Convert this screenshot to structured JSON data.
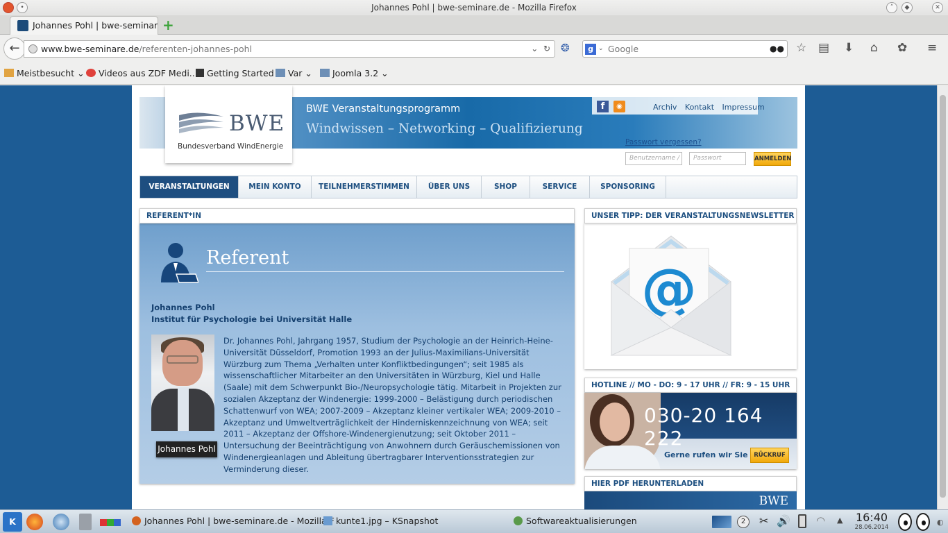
{
  "window": {
    "title": "Johannes Pohl | bwe-seminare.de - Mozilla Firefox"
  },
  "browser": {
    "tab_title": "Johannes Pohl | bwe-seminar…",
    "url_domain": "www.bwe-seminare.de",
    "url_path": "/referenten-johannes-pohl",
    "search_placeholder": "Google",
    "bookmarks": [
      "Meistbesucht",
      "Videos aus ZDF Medi...",
      "Getting Started",
      "Var",
      "Joomla 3.2"
    ]
  },
  "site": {
    "logo_text": "BWE",
    "logo_subtitle": "Bundesverband WindEnergie",
    "header_title": "BWE Veranstaltungsprogramm",
    "header_slogan": "Windwissen – Networking – Qualifizierung",
    "top_links": [
      "Archiv",
      "Kontakt",
      "Impressum"
    ],
    "password_forgot": "Passwort vergessen?",
    "username_placeholder": "Benutzername / E",
    "password_placeholder": "Passwort",
    "login_button": "ANMELDEN",
    "nav": [
      "VERANSTALTUNGEN",
      "MEIN KONTO",
      "TEILNEHMERSTIMMEN",
      "ÜBER UNS",
      "SHOP",
      "SERVICE",
      "SPONSORING"
    ],
    "nav_active": "VERANSTALTUNGEN"
  },
  "referent": {
    "box_label": "REFERENT*IN",
    "heading": "Referent",
    "name": "Johannes Pohl",
    "institution": "Institut für Psychologie bei Universität Halle",
    "photo_caption": "Johannes Pohl",
    "bio": "Dr. Johannes Pohl, Jahrgang 1957, Studium der Psychologie an der Heinrich-Heine-Universität Düsseldorf, Promotion 1993 an der Julius-Maximilians-Universität Würzburg zum Thema „Verhalten unter Konfliktbedingungen“; seit 1985 als wissenschaftlicher Mitarbeiter an den Universitäten in Würzburg, Kiel und Halle (Saale) mit dem Schwerpunkt Bio-/Neuropsychologie tätig. Mitarbeit in Projekten zur sozialen Akzeptanz der Windenergie: 1999-2000 – Belästigung durch periodischen Schattenwurf von WEA; 2007-2009 – Akzeptanz kleiner vertikaler WEA; 2009-2010 – Akzeptanz und Umweltverträglichkeit der Hinderniskennzeichnung von WEA; seit 2011 – Akzeptanz der Offshore-Windenergienutzung; seit Oktober 2011 – Untersuchung der Beeinträchtigung von Anwohnern durch Geräuschemissionen von Windenergieanlagen und Ableitung übertragbarer Interventionsstrategien zur Verminderung dieser."
  },
  "sidebar": {
    "newsletter_label": "UNSER TIPP: DER VERANSTALTUNGSNEWSLETTER",
    "hotline_label": "HOTLINE // MO - DO: 9 - 17 UHR // FR: 9 - 15 UHR",
    "hotline_number": "030-20 164 222",
    "callback_text": "Gerne rufen wir Sie an!",
    "callback_button": "RÜCKRUF",
    "pdf_label": "HIER PDF HERUNTERLADEN",
    "pdf_logo": "BWE"
  },
  "taskbar": {
    "tasks": [
      "Johannes Pohl | bwe-seminare.de - Mozilla F",
      "kunte1.jpg – KSnapshot",
      "Softwareaktualisierungen"
    ],
    "desktop_num": "2",
    "time": "16:40",
    "date": "28.06.2014"
  },
  "colors": {
    "brand_blue": "#1e4e80",
    "accent_orange": "#f1a90b",
    "page_bg": "#1d5c95"
  }
}
